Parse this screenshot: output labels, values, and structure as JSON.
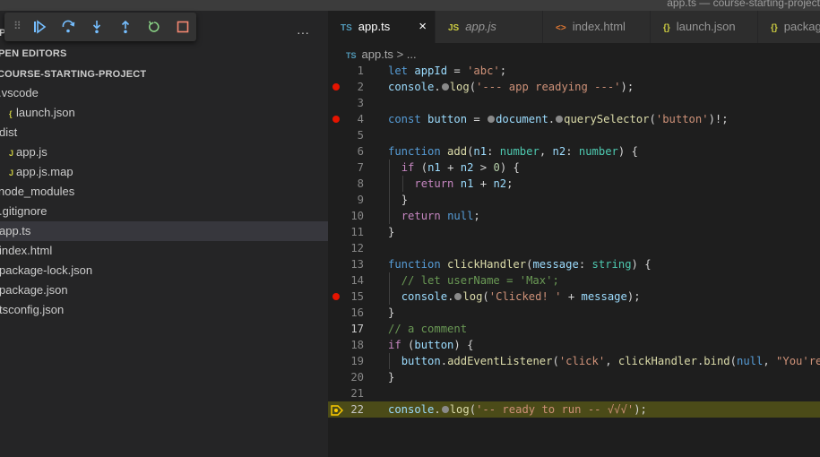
{
  "window": {
    "title": "app.ts — course-starting-project"
  },
  "sidebar": {
    "section_label_fragment": "P",
    "open_editors_label": "PEN EDITORS",
    "more_actions": "···",
    "project_label": "COURSE-STARTING-PROJECT",
    "items": [
      {
        "label": ".vscode",
        "icon": ""
      },
      {
        "label": "launch.json",
        "icon": "{"
      },
      {
        "label": "dist",
        "icon": ""
      },
      {
        "label": "app.js",
        "icon": "JS"
      },
      {
        "label": "app.js.map",
        "icon": "JS"
      },
      {
        "label": "node_modules",
        "icon": ""
      },
      {
        "label": ".gitignore",
        "icon": ""
      },
      {
        "label": "app.ts",
        "icon": "",
        "selected": true
      },
      {
        "label": "index.html",
        "icon": ""
      },
      {
        "label": "package-lock.json",
        "icon": ""
      },
      {
        "label": "package.json",
        "icon": ""
      },
      {
        "label": "tsconfig.json",
        "icon": ""
      }
    ]
  },
  "debug_toolbar": {
    "buttons": [
      "continue-icon",
      "step-over-icon",
      "step-into-icon",
      "step-out-icon",
      "restart-icon",
      "stop-icon"
    ],
    "colors": {
      "blue": "#75beff",
      "green": "#89d185",
      "red": "#f48771"
    }
  },
  "tabs": [
    {
      "icon": "TS",
      "icon_color": "#519aba",
      "label": "app.ts",
      "active": true,
      "close": "×"
    },
    {
      "icon": "JS",
      "icon_color": "#cbcb41",
      "label": "app.js",
      "italic": true
    },
    {
      "icon": "<>",
      "icon_color": "#e37933",
      "label": "index.html"
    },
    {
      "icon": "{}",
      "icon_color": "#cbcb41",
      "label": "launch.json"
    },
    {
      "icon": "{}",
      "icon_color": "#cbcb41",
      "label": "package.json"
    }
  ],
  "breadcrumbs": {
    "icon": "TS",
    "file": "app.ts",
    "separator": ">",
    "more": "..."
  },
  "editor": {
    "current_line": 22,
    "breakpoints": [
      2,
      4,
      15
    ],
    "lines": [
      {
        "n": "1",
        "tokens": [
          [
            "kw",
            "let"
          ],
          [
            "",
            " "
          ],
          [
            "var",
            "appId"
          ],
          [
            "",
            " = "
          ],
          [
            "str",
            "'abc'"
          ],
          [
            "",
            ";"
          ]
        ]
      },
      {
        "n": "2",
        "tokens": [
          [
            "var",
            "console"
          ],
          [
            "",
            "."
          ],
          [
            "dot",
            ""
          ],
          [
            "fn",
            "log"
          ],
          [
            "",
            "("
          ],
          [
            "str",
            "'--- app readying ---'"
          ],
          [
            "",
            ");"
          ]
        ]
      },
      {
        "n": "3",
        "tokens": []
      },
      {
        "n": "4",
        "tokens": [
          [
            "kw",
            "const"
          ],
          [
            "",
            " "
          ],
          [
            "var",
            "button"
          ],
          [
            "",
            " = "
          ],
          [
            "dot",
            ""
          ],
          [
            "var",
            "document"
          ],
          [
            "",
            "."
          ],
          [
            "dot",
            ""
          ],
          [
            "fn",
            "querySelector"
          ],
          [
            "",
            "("
          ],
          [
            "str",
            "'button'"
          ],
          [
            "",
            ")!;"
          ]
        ]
      },
      {
        "n": "5",
        "tokens": []
      },
      {
        "n": "6",
        "tokens": [
          [
            "kw",
            "function"
          ],
          [
            "",
            " "
          ],
          [
            "fn",
            "add"
          ],
          [
            "",
            "("
          ],
          [
            "var",
            "n1"
          ],
          [
            "",
            ": "
          ],
          [
            "ty",
            "number"
          ],
          [
            "",
            ", "
          ],
          [
            "var",
            "n2"
          ],
          [
            "",
            ": "
          ],
          [
            "ty",
            "number"
          ],
          [
            "",
            ") {"
          ]
        ]
      },
      {
        "n": "7",
        "indent": 1,
        "tokens": [
          [
            "ctl",
            "if"
          ],
          [
            "",
            " ("
          ],
          [
            "var",
            "n1"
          ],
          [
            "",
            " + "
          ],
          [
            "var",
            "n2"
          ],
          [
            "",
            " > "
          ],
          [
            "num",
            "0"
          ],
          [
            "",
            ") {"
          ]
        ]
      },
      {
        "n": "8",
        "indent": 2,
        "tokens": [
          [
            "ctl",
            "return"
          ],
          [
            "",
            " "
          ],
          [
            "var",
            "n1"
          ],
          [
            "",
            " + "
          ],
          [
            "var",
            "n2"
          ],
          [
            "",
            ";"
          ]
        ]
      },
      {
        "n": "9",
        "indent": 1,
        "tokens": [
          [
            "",
            "}"
          ]
        ]
      },
      {
        "n": "10",
        "indent": 1,
        "tokens": [
          [
            "ctl",
            "return"
          ],
          [
            "",
            " "
          ],
          [
            "kw",
            "null"
          ],
          [
            "",
            ";"
          ]
        ]
      },
      {
        "n": "11",
        "tokens": [
          [
            "",
            "}"
          ]
        ]
      },
      {
        "n": "12",
        "tokens": []
      },
      {
        "n": "13",
        "tokens": [
          [
            "kw",
            "function"
          ],
          [
            "",
            " "
          ],
          [
            "fn",
            "clickHandler"
          ],
          [
            "",
            "("
          ],
          [
            "var",
            "message"
          ],
          [
            "",
            ": "
          ],
          [
            "ty",
            "string"
          ],
          [
            "",
            ") {"
          ]
        ]
      },
      {
        "n": "14",
        "indent": 1,
        "tokens": [
          [
            "cm",
            "// let userName = 'Max';"
          ]
        ]
      },
      {
        "n": "15",
        "indent": 1,
        "tokens": [
          [
            "var",
            "console"
          ],
          [
            "",
            "."
          ],
          [
            "dot",
            ""
          ],
          [
            "fn",
            "log"
          ],
          [
            "",
            "("
          ],
          [
            "str",
            "'Clicked! '"
          ],
          [
            "",
            " + "
          ],
          [
            "var",
            "message"
          ],
          [
            "",
            ");"
          ]
        ]
      },
      {
        "n": "16",
        "tokens": [
          [
            "",
            "}"
          ]
        ]
      },
      {
        "n": "17",
        "tokens": [
          [
            "cm",
            "// a comment"
          ]
        ]
      },
      {
        "n": "18",
        "tokens": [
          [
            "ctl",
            "if"
          ],
          [
            "",
            " ("
          ],
          [
            "var",
            "button"
          ],
          [
            "",
            ") {"
          ]
        ]
      },
      {
        "n": "19",
        "indent": 1,
        "tokens": [
          [
            "var",
            "button"
          ],
          [
            "",
            "."
          ],
          [
            "fn",
            "addEventListener"
          ],
          [
            "",
            "("
          ],
          [
            "str",
            "'click'"
          ],
          [
            "",
            ", "
          ],
          [
            "fn",
            "clickHandler"
          ],
          [
            "",
            "."
          ],
          [
            "fn",
            "bind"
          ],
          [
            "",
            "("
          ],
          [
            "kw",
            "null"
          ],
          [
            "",
            ", "
          ],
          [
            "str",
            "\"You're"
          ]
        ]
      },
      {
        "n": "20",
        "tokens": [
          [
            "",
            "}"
          ]
        ]
      },
      {
        "n": "21",
        "tokens": []
      },
      {
        "n": "22",
        "tokens": [
          [
            "var",
            "console"
          ],
          [
            "",
            "."
          ],
          [
            "dot",
            ""
          ],
          [
            "fn",
            "log"
          ],
          [
            "",
            "("
          ],
          [
            "str",
            "'-- ready to run -- √√√'"
          ],
          [
            "",
            ");"
          ]
        ]
      }
    ]
  },
  "colors": {
    "breakpoint": "#e51400",
    "current_line_bg": "#4b4b18",
    "current_line_arrow": "#ffcc00",
    "selection": "#37373d"
  }
}
